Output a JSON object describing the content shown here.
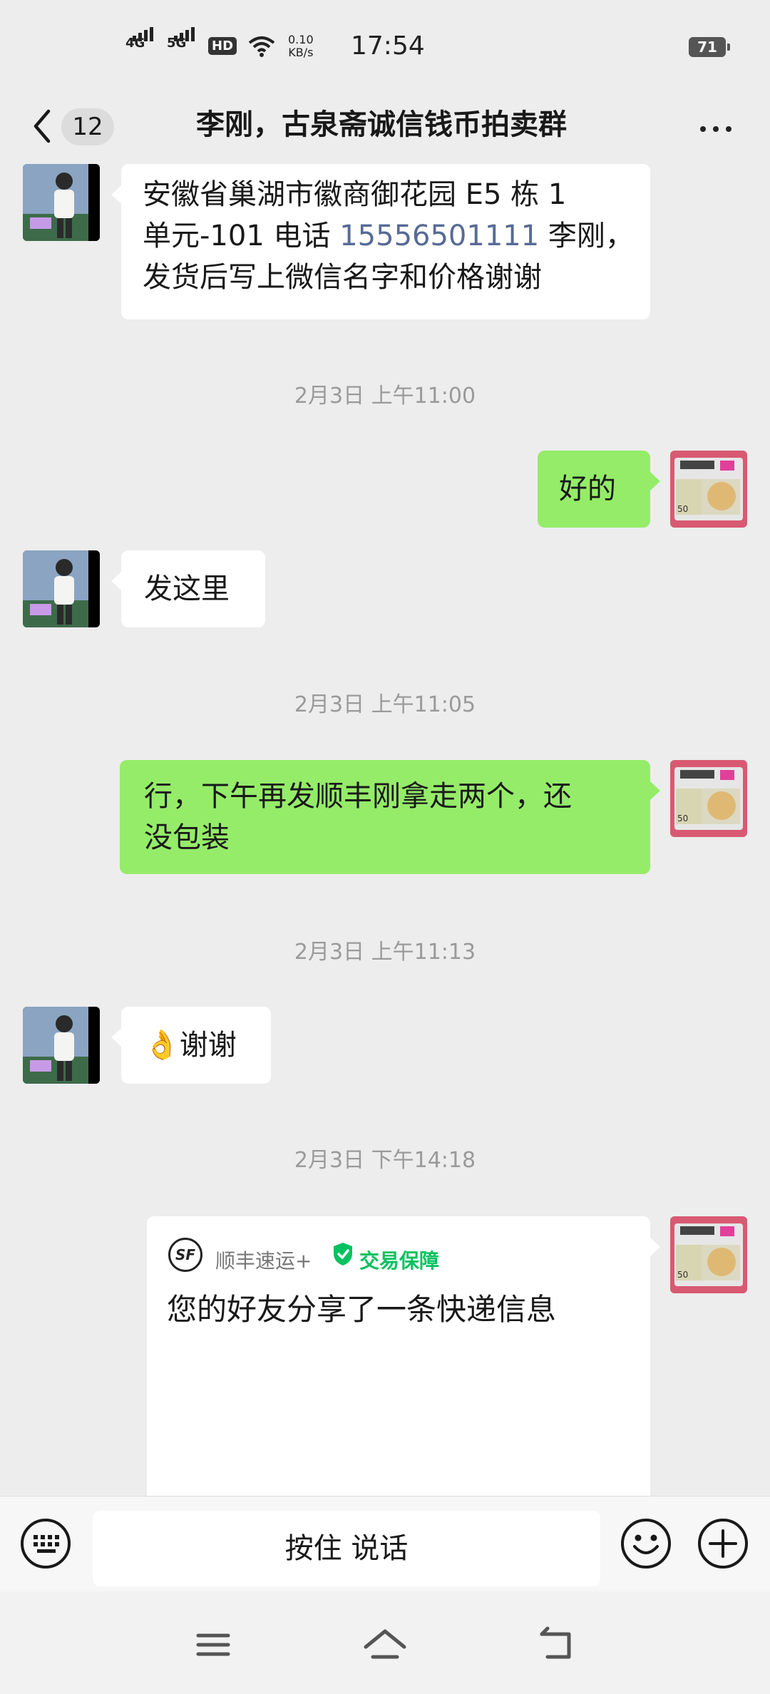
{
  "status_bar": {
    "network1": "4G",
    "network2": "5G",
    "hd": "HD",
    "speed_value": "0.10",
    "speed_unit": "KB/s",
    "time": "17:54",
    "battery": "71"
  },
  "header": {
    "unread_count": "12",
    "title": "李刚，古泉斋诚信钱币拍卖群"
  },
  "messages": {
    "m1": {
      "line1": "安徽省巢湖市徽商御花园 E5 栋 1",
      "line2_pre": "单元-101 电话 ",
      "phone": "15556501111",
      "line2_post": " 李刚，",
      "line3": "发货后写上微信名字和价格谢谢"
    },
    "ts1": "2月3日 上午11:00",
    "m2": "好的",
    "m3": "发这里",
    "ts2": "2月3日 上午11:05",
    "m4": {
      "line1": "行，下午再发顺丰刚拿走两个，还",
      "line2": "没包装"
    },
    "ts3": "2月3日 上午11:13",
    "m5": "👌谢谢",
    "ts4": "2月3日 下午14:18",
    "card": {
      "logo": "SF",
      "brand": "顺丰速运+",
      "guarantee": "交易保障",
      "text": "您的好友分享了一条快递信息"
    }
  },
  "input_bar": {
    "voice_label": "按住 说话"
  },
  "colors": {
    "background": "#ededed",
    "my_bubble": "#95ec69",
    "link": "#576b95",
    "guarantee_green": "#07c160"
  },
  "icons": [
    "back-arrow-icon",
    "more-icon",
    "keyboard-icon",
    "emoji-icon",
    "plus-icon",
    "menu-icon",
    "home-icon",
    "return-icon",
    "sf-logo-icon",
    "shield-icon"
  ]
}
